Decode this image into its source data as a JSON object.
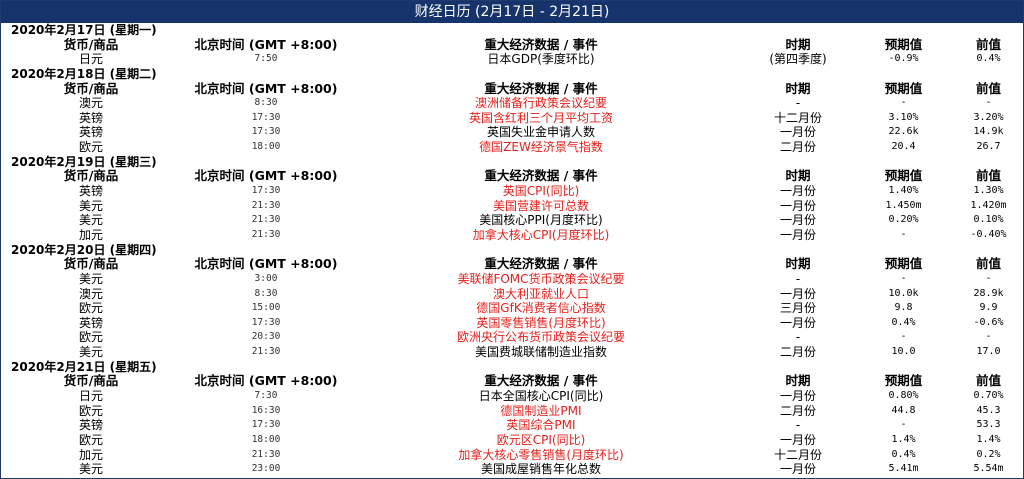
{
  "title": "财经日历 (2月17日 - 2月21日)",
  "colors": {
    "title_bg": "#17336b",
    "title_text": "#ffffff",
    "highlight_event": "#e8201c"
  },
  "headers": {
    "currency": "货币/商品",
    "time": "北京时间 (GMT +8:00)",
    "event": "重大经济数据 / 事件",
    "period": "时期",
    "forecast": "预期值",
    "previous": "前值"
  },
  "days": [
    {
      "date": "2020年2月17日 (星期一)",
      "events": [
        {
          "currency": "日元",
          "time": "7:50",
          "event": "日本GDP(季度环比)",
          "highlight": false,
          "period": "(第四季度)",
          "forecast": "-0.9%",
          "previous": "0.4%"
        }
      ]
    },
    {
      "date": "2020年2月18日 (星期二)",
      "events": [
        {
          "currency": "澳元",
          "time": "8:30",
          "event": "澳洲储备行政策会议纪要",
          "highlight": true,
          "period": "-",
          "forecast": "-",
          "previous": "-"
        },
        {
          "currency": "英镑",
          "time": "17:30",
          "event": "英国含红利三个月平均工资",
          "highlight": true,
          "period": "十二月份",
          "forecast": "3.10%",
          "previous": "3.20%"
        },
        {
          "currency": "英镑",
          "time": "17:30",
          "event": "英国失业金申请人数",
          "highlight": false,
          "period": "一月份",
          "forecast": "22.6k",
          "previous": "14.9k"
        },
        {
          "currency": "欧元",
          "time": "18:00",
          "event": "德国ZEW经济景气指数",
          "highlight": true,
          "period": "二月份",
          "forecast": "20.4",
          "previous": "26.7"
        }
      ]
    },
    {
      "date": "2020年2月19日 (星期三)",
      "events": [
        {
          "currency": "英镑",
          "time": "17:30",
          "event": "英国CPI(同比)",
          "highlight": true,
          "period": "一月份",
          "forecast": "1.40%",
          "previous": "1.30%"
        },
        {
          "currency": "美元",
          "time": "21:30",
          "event": "美国营建许可总数",
          "highlight": true,
          "period": "一月份",
          "forecast": "1.450m",
          "previous": "1.420m"
        },
        {
          "currency": "美元",
          "time": "21:30",
          "event": "美国核心PPI(月度环比)",
          "highlight": false,
          "period": "一月份",
          "forecast": "0.20%",
          "previous": "0.10%"
        },
        {
          "currency": "加元",
          "time": "21:30",
          "event": "加拿大核心CPI(月度环比)",
          "highlight": true,
          "period": "一月份",
          "forecast": "-",
          "previous": "-0.40%"
        }
      ]
    },
    {
      "date": "2020年2月20日 (星期四)",
      "events": [
        {
          "currency": "美元",
          "time": "3:00",
          "event": "美联储FOMC货币政策会议纪要",
          "highlight": true,
          "period": "-",
          "forecast": "-",
          "previous": "-"
        },
        {
          "currency": "澳元",
          "time": "8:30",
          "event": "澳大利亚就业人口",
          "highlight": true,
          "period": "一月份",
          "forecast": "10.0k",
          "previous": "28.9k"
        },
        {
          "currency": "欧元",
          "time": "15:00",
          "event": "德国GfK消费者信心指数",
          "highlight": true,
          "period": "三月份",
          "forecast": "9.8",
          "previous": "9.9"
        },
        {
          "currency": "英镑",
          "time": "17:30",
          "event": "英国零售销售(月度环比)",
          "highlight": true,
          "period": "一月份",
          "forecast": "0.4%",
          "previous": "-0.6%"
        },
        {
          "currency": "欧元",
          "time": "20:30",
          "event": "欧洲央行公布货币政策会议纪要",
          "highlight": true,
          "period": "-",
          "forecast": "-",
          "previous": "-"
        },
        {
          "currency": "美元",
          "time": "21:30",
          "event": "美国费城联储制造业指数",
          "highlight": false,
          "period": "二月份",
          "forecast": "10.0",
          "previous": "17.0"
        }
      ]
    },
    {
      "date": "2020年2月21日 (星期五)",
      "events": [
        {
          "currency": "日元",
          "time": "7:30",
          "event": "日本全国核心CPI(同比)",
          "highlight": false,
          "period": "一月份",
          "forecast": "0.80%",
          "previous": "0.70%"
        },
        {
          "currency": "欧元",
          "time": "16:30",
          "event": "德国制造业PMI",
          "highlight": true,
          "period": "二月份",
          "forecast": "44.8",
          "previous": "45.3"
        },
        {
          "currency": "英镑",
          "time": "17:30",
          "event": "英国综合PMI",
          "highlight": true,
          "period": "-",
          "forecast": "-",
          "previous": "53.3"
        },
        {
          "currency": "欧元",
          "time": "18:00",
          "event": "欧元区CPI(同比)",
          "highlight": true,
          "period": "一月份",
          "forecast": "1.4%",
          "previous": "1.4%"
        },
        {
          "currency": "加元",
          "time": "21:30",
          "event": "加拿大核心零售销售(月度环比)",
          "highlight": true,
          "period": "十二月份",
          "forecast": "0.4%",
          "previous": "0.2%"
        },
        {
          "currency": "美元",
          "time": "23:00",
          "event": "美国成屋销售年化总数",
          "highlight": false,
          "period": "一月份",
          "forecast": "5.41m",
          "previous": "5.54m"
        }
      ]
    }
  ]
}
